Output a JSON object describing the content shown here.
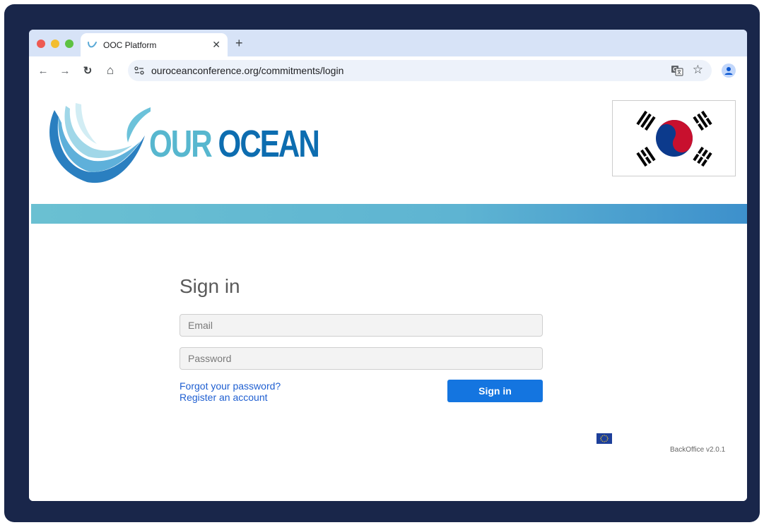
{
  "browser": {
    "tab": {
      "title": "OOC Platform",
      "close_glyph": "✕"
    },
    "new_tab_glyph": "+",
    "url": "ouroceanconference.org/commitments/login",
    "nav": {
      "back_glyph": "←",
      "forward_glyph": "→",
      "reload_glyph": "↻",
      "home_glyph": "⌂"
    },
    "star_glyph": "☆",
    "icons": [
      "ocean-wave-favicon-icon",
      "site-settings-icon",
      "translate-icon",
      "star-icon",
      "profile-icon"
    ]
  },
  "header": {
    "logo": {
      "word1": "OUR",
      "word2": "OCEAN"
    },
    "flag": "south-korea-flag-icon",
    "band_colors": [
      "#6ac0d2",
      "#3d90cc"
    ]
  },
  "signin": {
    "title": "Sign in",
    "email_placeholder": "Email",
    "password_placeholder": "Password",
    "forgot_label": "Forgot your password?",
    "register_label": "Register an account",
    "submit_label": "Sign in",
    "accent_color": "#1475e0"
  },
  "footer": {
    "version": "BackOffice v2.0.1",
    "eu_flag": "eu-flag-icon"
  }
}
